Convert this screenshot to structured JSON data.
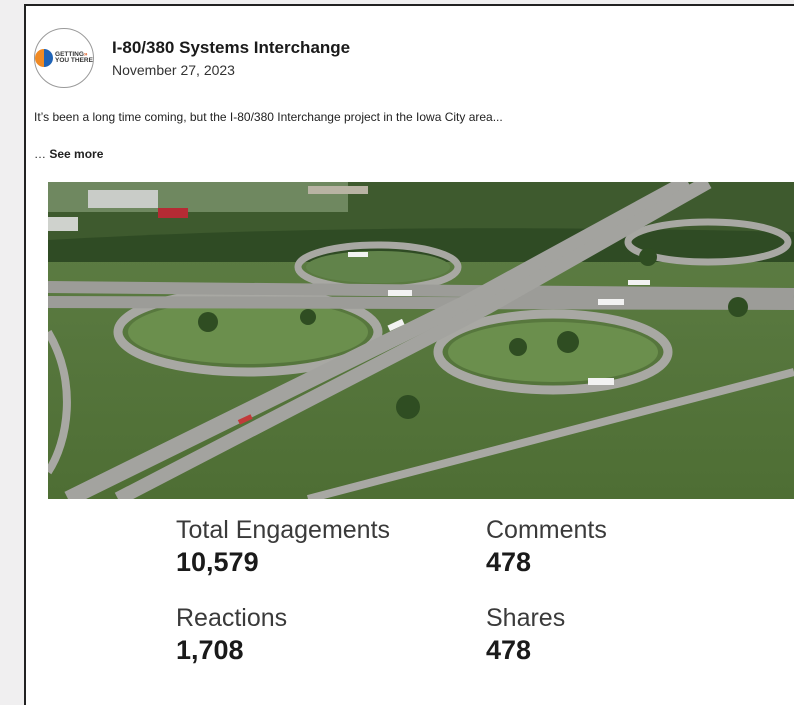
{
  "post": {
    "title": "I-80/380 Systems Interchange",
    "date": "November 27, 2023",
    "excerpt": "It’s been a long time coming, but the I-80/380 Interchange project in the Iowa City area...",
    "ellipsis": "… ",
    "see_more_label": "See more",
    "avatar_logo_line1": "GETTING",
    "avatar_logo_line2": "YOU THERE",
    "avatar_logo_arrows": "»"
  },
  "stats": {
    "total_engagements": {
      "label": "Total Engagements",
      "value": "10,579"
    },
    "comments": {
      "label": "Comments",
      "value": "478"
    },
    "reactions": {
      "label": "Reactions",
      "value": "1,708"
    },
    "shares": {
      "label": "Shares",
      "value": "478"
    }
  },
  "colors": {
    "page_background": "#f0eff0",
    "card_background": "#ffffff",
    "logo_blue": "#1f63b6",
    "logo_orange": "#f08a24"
  }
}
